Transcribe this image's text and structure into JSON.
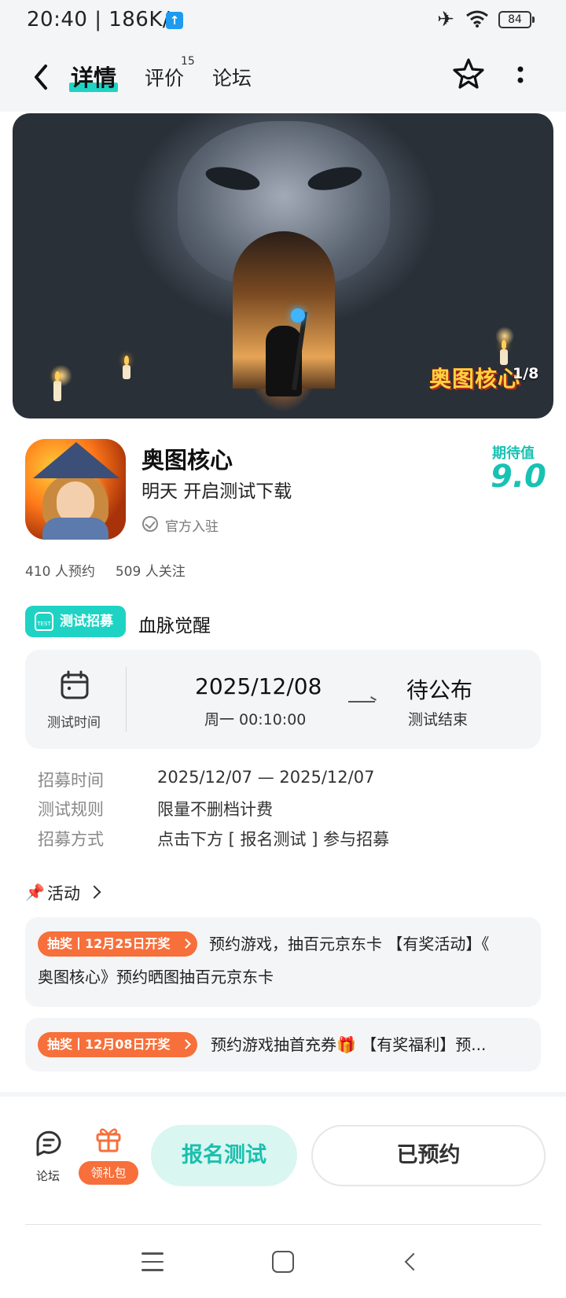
{
  "status_bar": {
    "time_speed": "20:40 | 186K/s",
    "upload_icon": "↑",
    "battery": "84"
  },
  "nav": {
    "tabs": [
      {
        "label": "详情",
        "active": true
      },
      {
        "label": "评价",
        "count": "15"
      },
      {
        "label": "论坛"
      }
    ],
    "star_icon": "star-smile-icon",
    "more_icon": "more-vertical-icon"
  },
  "banner": {
    "logo_text": "奥图核心",
    "counter": "1/8"
  },
  "app": {
    "name": "奥图核心",
    "subtitle": "明天 开启测试下载",
    "official_label": "官方入驻",
    "expect_label": "期待值",
    "expect_value": "9.0",
    "reservations": "410 人预约",
    "followers": "509 人关注"
  },
  "test": {
    "tag_label": "测试招募",
    "tag_icon_text": "TEST",
    "title": "血脉觉醒",
    "time_label": "测试时间",
    "start_date": "2025/12/08",
    "start_time": "周一  00:10:00",
    "end_value": "待公布",
    "end_label": "测试结束"
  },
  "details": [
    {
      "label": "招募时间",
      "value": "2025/12/07 — 2025/12/07"
    },
    {
      "label": "测试规则",
      "value": "限量不删档计费"
    },
    {
      "label": "招募方式",
      "value": "点击下方 [ 报名测试 ] 参与招募"
    }
  ],
  "activities": {
    "title": "活动",
    "items": [
      {
        "badge": "抽奖丨12月25日开奖",
        "line1": "预约游戏，抽百元京东卡 【有奖活动】《",
        "line2": "奥图核心》预约晒图抽百元京东卡"
      },
      {
        "badge": "抽奖丨12月08日开奖",
        "line1": "预约游戏抽首充券🎁 【有奖福利】预..."
      }
    ]
  },
  "bottom_bar": {
    "forum_label": "论坛",
    "gift_label": "领礼包",
    "signup_label": "报名测试",
    "reserved_label": "已预约"
  },
  "colors": {
    "accent": "#1ed3c4",
    "orange": "#f76f3a",
    "card_bg": "#f4f5f7"
  }
}
